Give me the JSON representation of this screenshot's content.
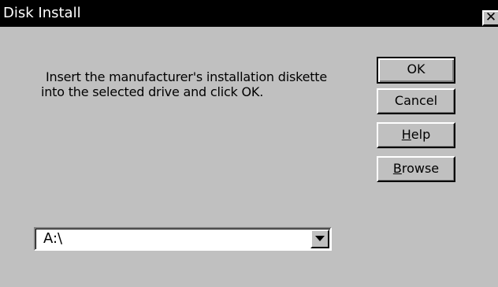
{
  "window": {
    "title": "Disk Install",
    "close_glyph": "✕"
  },
  "message": {
    "line1": "Insert the manufacturer's installation diskette",
    "line2": "into the selected drive and click OK."
  },
  "buttons": {
    "ok": {
      "label": "OK"
    },
    "cancel": {
      "label": "Cancel"
    },
    "help": {
      "mnemonic": "H",
      "rest": "elp"
    },
    "browse": {
      "mnemonic": "B",
      "rest": "rowse"
    }
  },
  "drive_combo": {
    "value": "A:\\",
    "arrow_icon": "chevron-down-icon"
  },
  "colors": {
    "face": "#c0c0c0",
    "titlebar": "#000000",
    "title_text": "#ffffff"
  }
}
